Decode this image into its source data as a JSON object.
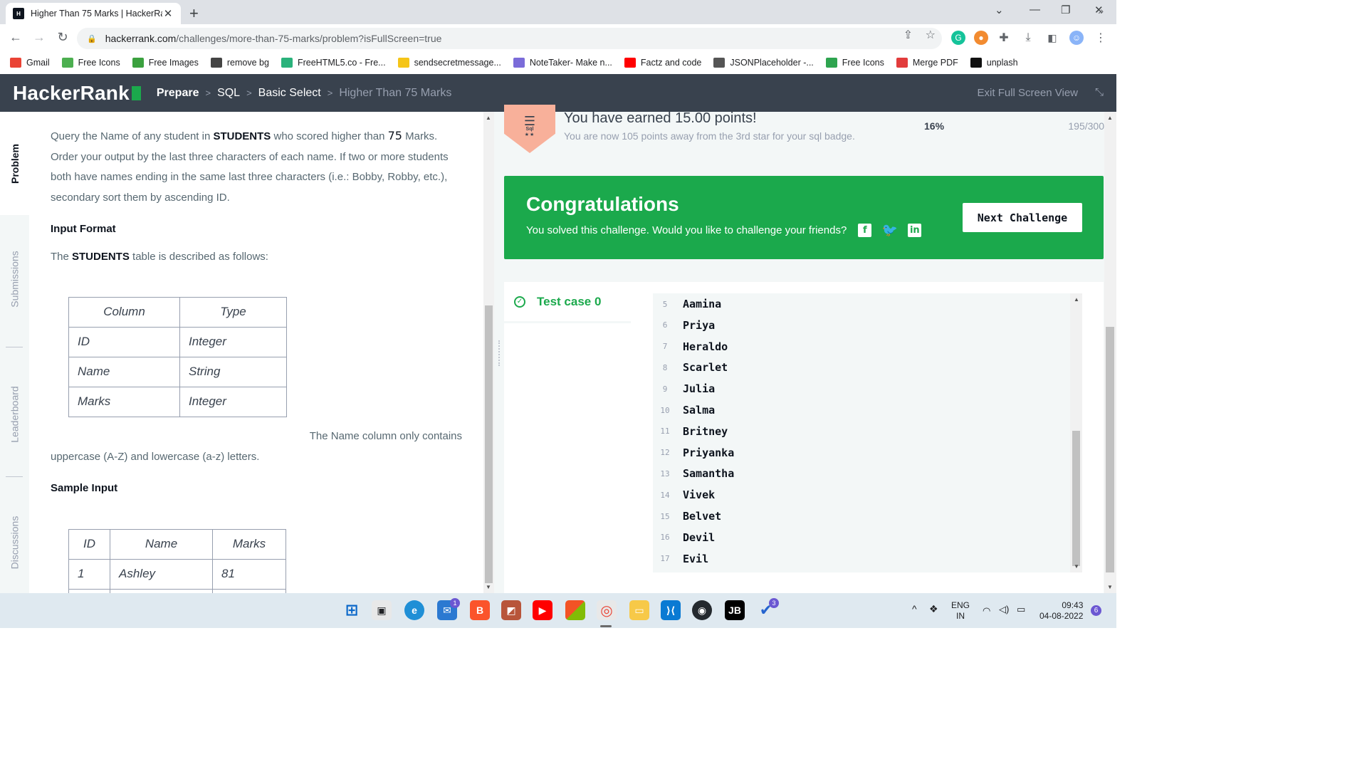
{
  "browser": {
    "tab_title": "Higher Than 75 Marks | HackerRa",
    "url_host": "hackerrank.com",
    "url_path": "/challenges/more-than-75-marks/problem?isFullScreen=true"
  },
  "bookmarks": [
    {
      "label": "Gmail",
      "icon": "gmail-icon",
      "color": "#ea4335"
    },
    {
      "label": "Free Icons",
      "icon": "leaf-icon",
      "color": "#4caf50"
    },
    {
      "label": "Free Images",
      "icon": "px-icon",
      "color": "#3ba13f"
    },
    {
      "label": "remove bg",
      "icon": "layers-icon",
      "color": "#444"
    },
    {
      "label": "FreeHTML5.co - Fre...",
      "icon": "flag-icon",
      "color": "#2ab27b"
    },
    {
      "label": "sendsecretmessage...",
      "icon": "emoji-icon",
      "color": "#f5c518"
    },
    {
      "label": "NoteTaker- Make n...",
      "icon": "note-icon",
      "color": "#7b6cd9"
    },
    {
      "label": "Factz and code",
      "icon": "youtube-icon",
      "color": "#ff0000"
    },
    {
      "label": "JSONPlaceholder -...",
      "icon": "json-icon",
      "color": "#555"
    },
    {
      "label": "Free Icons",
      "icon": "icons-icon",
      "color": "#2ea44f"
    },
    {
      "label": "Merge PDF",
      "icon": "merge-icon",
      "color": "#e23c3c"
    },
    {
      "label": "unplash",
      "icon": "unsplash-icon",
      "color": "#111"
    }
  ],
  "nav": {
    "logo": "HackerRank",
    "crumbs": [
      "Prepare",
      "SQL",
      "Basic Select",
      "Higher Than 75 Marks"
    ],
    "exit": "Exit Full Screen View"
  },
  "sidetabs": [
    "Problem",
    "Submissions",
    "Leaderboard",
    "Discussions"
  ],
  "problem": {
    "p1_a": "Query the Name of any student in ",
    "p1_b": "STUDENTS",
    "p1_c": " who scored higher than ",
    "p1_d": "75",
    "p1_e": " Marks. Order your output by the last three characters of each name. If two or more students both have names ending in the same last three characters (i.e.: Bobby, Robby, etc.), secondary sort them by ascending ID.",
    "input_format": "Input Format",
    "p2_a": "The ",
    "p2_b": "STUDENTS",
    "p2_c": " table is described as follows:",
    "desc_headers": [
      "Column",
      "Type"
    ],
    "desc_rows": [
      [
        "ID",
        "Integer"
      ],
      [
        "Name",
        "String"
      ],
      [
        "Marks",
        "Integer"
      ]
    ],
    "trail1": "The Name column only contains",
    "trail2": "uppercase (A-Z) and lowercase (a-z) letters.",
    "sample_input": "Sample Input",
    "sample_headers": [
      "ID",
      "Name",
      "Marks"
    ],
    "sample_rows": [
      [
        "1",
        "Ashley",
        "81"
      ]
    ]
  },
  "score": {
    "badge": "Sql",
    "earned": "You have earned 15.00 points!",
    "away": "You are now 105 points away from the 3rd star for your sql badge.",
    "percent": "16%",
    "points": "195/300",
    "progress": 0.16
  },
  "congrats": {
    "title": "Congratulations",
    "message": "You solved this challenge. Would you like to challenge your friends?",
    "next": "Next Challenge"
  },
  "testcase": {
    "label": "Test case 0",
    "lines": [
      {
        "n": "5",
        "text": "Aamina"
      },
      {
        "n": "6",
        "text": "Priya"
      },
      {
        "n": "7",
        "text": "Heraldo"
      },
      {
        "n": "8",
        "text": "Scarlet"
      },
      {
        "n": "9",
        "text": "Julia"
      },
      {
        "n": "10",
        "text": "Salma"
      },
      {
        "n": "11",
        "text": "Britney"
      },
      {
        "n": "12",
        "text": "Priyanka"
      },
      {
        "n": "13",
        "text": "Samantha"
      },
      {
        "n": "14",
        "text": "Vivek"
      },
      {
        "n": "15",
        "text": "Belvet"
      },
      {
        "n": "16",
        "text": "Devil"
      },
      {
        "n": "17",
        "text": "Evil"
      }
    ]
  },
  "taskbar": {
    "lang": "ENG",
    "region": "IN",
    "time": "09:43",
    "date": "04-08-2022",
    "notif": "6",
    "mail_badge": "1",
    "todo_badge": "3"
  }
}
